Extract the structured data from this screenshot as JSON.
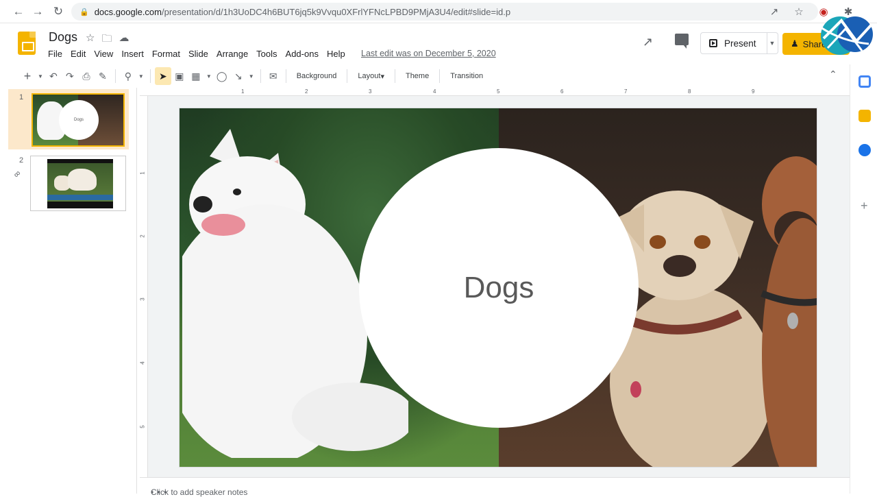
{
  "browser": {
    "url_host": "docs.google.com",
    "url_path": "/presentation/d/1h3UoDC4h6BUT6jq5k9Vvqu0XFrlYFNcLPBD9PMjA3U4/edit#slide=id.p"
  },
  "header": {
    "title": "Dogs",
    "last_edit": "Last edit was on December 5, 2020",
    "present_label": "Present",
    "share_label": "Share"
  },
  "menu": [
    "File",
    "Edit",
    "View",
    "Insert",
    "Format",
    "Slide",
    "Arrange",
    "Tools",
    "Add-ons",
    "Help"
  ],
  "toolbar": {
    "background_label": "Background",
    "layout_label": "Layout",
    "theme_label": "Theme",
    "transition_label": "Transition"
  },
  "filmstrip": {
    "slides": [
      {
        "number": "1",
        "thumb_text": "Dogs"
      },
      {
        "number": "2"
      }
    ]
  },
  "ruler": {
    "top": [
      "1",
      "2",
      "3",
      "4",
      "5",
      "6",
      "7",
      "8",
      "9"
    ],
    "left": [
      "1",
      "2",
      "3",
      "4",
      "5"
    ]
  },
  "slide": {
    "title": "Dogs"
  },
  "notes": {
    "placeholder": "Click to add speaker notes"
  },
  "colors": {
    "accent": "#f4b400",
    "selection": "#fce8cb"
  }
}
